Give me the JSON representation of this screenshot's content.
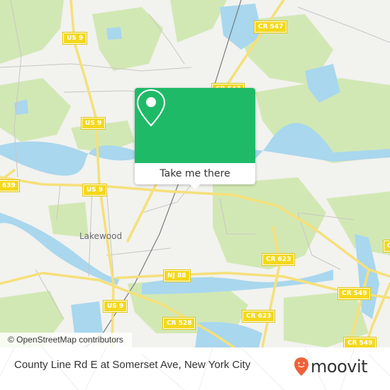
{
  "map": {
    "place_labels": [
      {
        "id": "lakewood",
        "text": "Lakewood"
      }
    ],
    "road_shields": [
      {
        "id": "us9-north",
        "text": "US 9"
      },
      {
        "id": "us9-mid",
        "text": "US 9"
      },
      {
        "id": "us9-center",
        "text": "US 9"
      },
      {
        "id": "us9-south",
        "text": "US 9"
      },
      {
        "id": "cr547-north",
        "text": "CR 547"
      },
      {
        "id": "cr547-south",
        "text": "CR 547"
      },
      {
        "id": "cr639",
        "text": "639"
      },
      {
        "id": "nj88",
        "text": "NJ 88"
      },
      {
        "id": "cr528",
        "text": "CR 528"
      },
      {
        "id": "cr623-north",
        "text": "CR 623"
      },
      {
        "id": "cr623-south",
        "text": "CR 623"
      },
      {
        "id": "cr549-mid",
        "text": "CR 549"
      },
      {
        "id": "cr549-south",
        "text": "CR 549"
      },
      {
        "id": "cr549-edge",
        "text": "C"
      }
    ],
    "attribution": "© OpenStreetMap contributors",
    "colors": {
      "land": "#f2f2ef",
      "park": "#cfe6b0",
      "water": "#a8d8ef",
      "road_major": "#f5e07a",
      "shield": "#f3d81c"
    }
  },
  "popup": {
    "icon": "map-pin-icon",
    "button_label": "Take me there",
    "color": "#1fba68"
  },
  "footer": {
    "stop_title": "County Line Rd E at Somerset Ave, New York City",
    "logo_text": "moovit",
    "logo_icon": "moovit-pin-icon",
    "logo_color": "#f0613a"
  }
}
